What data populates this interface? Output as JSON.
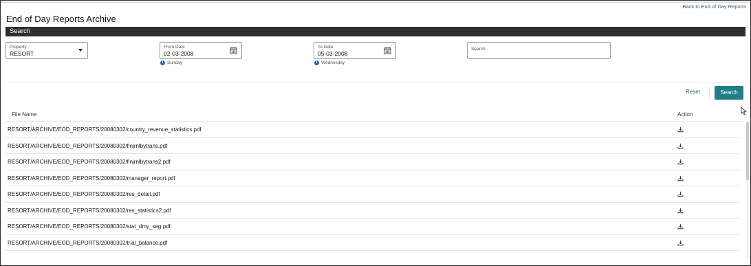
{
  "header": {
    "back_link": "Back to End of Day Reports",
    "title": "End of Day Reports Archive"
  },
  "search_section": {
    "heading": "Search",
    "property": {
      "label": "Property",
      "value": "RESORT"
    },
    "from_date": {
      "label": "From Date",
      "value": "02-03-2008",
      "day_hint": "Sunday"
    },
    "to_date": {
      "label": "To Date",
      "value": "05-03-2008",
      "day_hint": "Wednesday"
    },
    "search_field": {
      "label": "Search",
      "value": ""
    },
    "reset_label": "Reset",
    "search_label": "Search"
  },
  "table": {
    "columns": [
      "File Name",
      "Action"
    ],
    "rows": [
      {
        "file": "RESORT/ARCHIVE/EOD_REPORTS/20080302/country_revenue_statistics.pdf",
        "action_icon": "download-icon"
      },
      {
        "file": "RESORT/ARCHIVE/EOD_REPORTS/20080302/finjrnlbytrans.pdf",
        "action_icon": "download-icon"
      },
      {
        "file": "RESORT/ARCHIVE/EOD_REPORTS/20080302/finjrnlbytrans2.pdf",
        "action_icon": "download-icon"
      },
      {
        "file": "RESORT/ARCHIVE/EOD_REPORTS/20080302/manager_report.pdf",
        "action_icon": "download-icon"
      },
      {
        "file": "RESORT/ARCHIVE/EOD_REPORTS/20080302/res_detail.pdf",
        "action_icon": "download-icon"
      },
      {
        "file": "RESORT/ARCHIVE/EOD_REPORTS/20080302/res_statistics2.pdf",
        "action_icon": "download-icon"
      },
      {
        "file": "RESORT/ARCHIVE/EOD_REPORTS/20080302/stat_dmy_seg.pdf",
        "action_icon": "download-icon"
      },
      {
        "file": "RESORT/ARCHIVE/EOD_REPORTS/20080302/trial_balance.pdf",
        "action_icon": "download-icon"
      }
    ]
  },
  "colors": {
    "search_bar_bg": "#312d2a",
    "primary_button": "#227e86",
    "link": "#2d5f83",
    "info_icon": "#2d6a9f"
  }
}
